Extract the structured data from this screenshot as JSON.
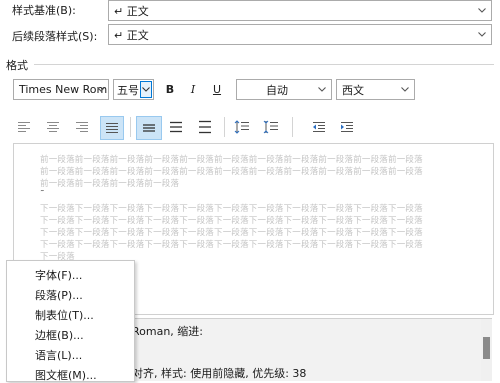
{
  "style_based_on": {
    "label": "样式基准(B):",
    "value": "↵ 正文"
  },
  "next_style": {
    "label": "后续段落样式(S):",
    "value": "↵ 正文"
  },
  "format_section": {
    "title": "格式",
    "font_name": "Times New Rom",
    "font_size": "五号",
    "bold": "B",
    "italic": "I",
    "underline": "U",
    "color": "自动",
    "script": "西文"
  },
  "preview": {
    "prev_lines": [
      "前一段落前一段落前一段落前一段落前一段落前一段落前一段落前一段落前一段落前一段落前一段落",
      "前一段落前一段落前一段落前一段落前一段落前一段落前一段落前一段落前一段落前一段落前一段落",
      "前一段落前一段落前一段落前一段落"
    ],
    "mark": "˜",
    "next_lines": [
      "下一段落下一段落下一段落下一段落下一段落下一段落下一段落下一段落下一段落下一段落下一段落",
      "下一段落下一段落下一段落下一段落下一段落下一段落下一段落下一段落下一段落下一段落下一段落",
      "下一段落下一段落下一段落下一段落下一段落下一段落下一段落下一段落下一段落下一段落下一段落",
      "下一段落下一段落下一段落下一段落下一段落下一段落下一段落下一段落下一段落下一段落下一段落",
      "下一段落"
    ]
  },
  "description": {
    "line1": "Roman, 缩进:",
    "line2": "对齐, 样式: 使用前隐藏, 优先级: 38"
  },
  "format_menu": {
    "items": [
      "字体(F)...",
      "段落(P)...",
      "制表位(T)...",
      "边框(B)...",
      "语言(L)...",
      "图文框(M)..."
    ]
  },
  "icons": {
    "toolbar": [
      "align-left-icon",
      "align-center-icon",
      "align-right-icon",
      "justify-icon",
      "single-spacing-icon",
      "one-half-spacing-icon",
      "double-spacing-icon",
      "increase-paragraph-spacing-icon",
      "decrease-paragraph-spacing-icon",
      "decrease-indent-icon",
      "increase-indent-icon"
    ]
  },
  "colors": {
    "accent": "#0078d7",
    "selected_bg": "#cce4f7",
    "preview_text": "#c4c4c4"
  }
}
